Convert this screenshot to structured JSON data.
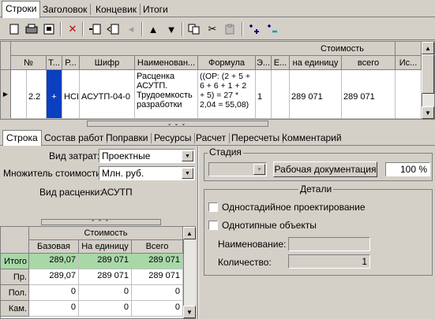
{
  "top_tabs": [
    "Строки",
    "Заголовок",
    "Концевик",
    "Итоги"
  ],
  "toolbar": {
    "icons": [
      "new-doc-icon",
      "print-icon",
      "save-icon",
      "delete-icon",
      "insert-row-icon",
      "outdent-icon",
      "indent-icon",
      "move-up-icon",
      "move-down-icon",
      "copy-icon",
      "cut-icon",
      "paste-icon",
      "expand-icon",
      "collapse-icon"
    ]
  },
  "grid": {
    "group_header": "Стоимость",
    "columns": [
      "№",
      "Т...",
      "Р...",
      "Шифр",
      "Наименован...",
      "Формула",
      "Э...",
      "Е...",
      "на единицу",
      "всего",
      "Ис..."
    ],
    "row": {
      "num": "2.2",
      "type": "+",
      "r": "НСІ",
      "code": "АСУТП-04-0",
      "name": "Расценка АСУТП. Трудоемкость разработки",
      "formula": "((ОР: (2 + 5 + 6 + 6 + 1 + 2 + 5) = 27 * 2,04 = 55,08)",
      "e": "1",
      "per_unit": "289 071",
      "total": "289 071"
    }
  },
  "bottom_tabs": [
    "Строка",
    "Состав работ",
    "Поправки",
    "Ресурсы",
    "Расчет",
    "Пересчеты",
    "Комментарий"
  ],
  "form": {
    "cost_type_label": "Вид затрат:",
    "cost_type_value": "Проектные",
    "multiplier_label": "Множитель стоимости:",
    "multiplier_value": "Млн. руб.",
    "rate_type_label": "Вид расценки:",
    "rate_type_value": "АСУТП"
  },
  "stage": {
    "title": "Стадия",
    "combo_value": "",
    "doc_button": "Рабочая документация",
    "percent": "100 %"
  },
  "details": {
    "title": "Детали",
    "single_stage": "Одностадийное проектирование",
    "same_type": "Однотипные объекты",
    "name_label": "Наименование:",
    "name_value": "",
    "qty_label": "Количество:",
    "qty_value": "1"
  },
  "cost_table": {
    "group_header": "Стоимость",
    "columns": [
      "Базовая",
      "На единицу",
      "Всего"
    ],
    "rows": [
      {
        "label": "Итого",
        "base": "289,07",
        "unit": "289 071",
        "total": "289 071"
      },
      {
        "label": "Пр.",
        "base": "289,07",
        "unit": "289 071",
        "total": "289 071"
      },
      {
        "label": "Пол.",
        "base": "0",
        "unit": "0",
        "total": "0"
      },
      {
        "label": "Кам.",
        "base": "0",
        "unit": "0",
        "total": "0"
      }
    ]
  }
}
